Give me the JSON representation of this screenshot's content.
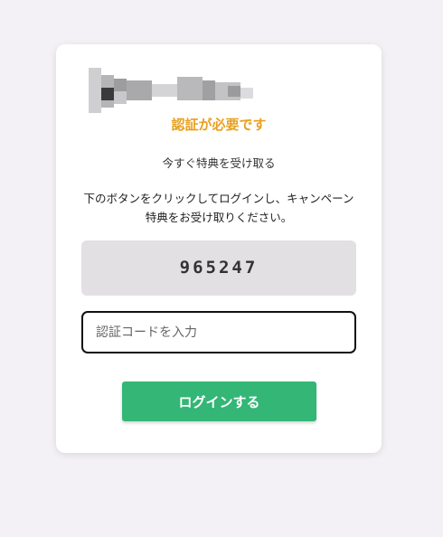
{
  "colors": {
    "accent": "#e8a020",
    "button": "#33b676",
    "code_box": "#e2e0e3"
  },
  "verification": {
    "title": "認証が必要です",
    "subtitle": "今すぐ特典を受け取る",
    "instruction": "下のボタンをクリックしてログインし、キャンペーン特典をお受け取りください。",
    "code": "965247",
    "input_placeholder": "認証コードを入力",
    "login_label": "ログインする"
  }
}
